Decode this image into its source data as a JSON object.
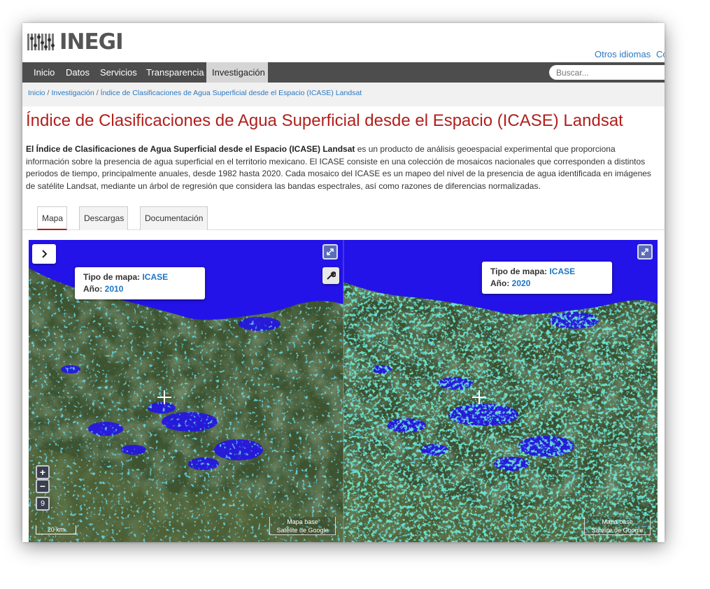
{
  "header": {
    "logo_text": "INEGI",
    "lang_link": "Otros idiomas",
    "extra_link": "Co"
  },
  "nav": {
    "items": [
      "Inicio",
      "Datos",
      "Servicios",
      "Transparencia",
      "Investigación"
    ],
    "search_placeholder": "Buscar..."
  },
  "breadcrumb": {
    "items": [
      "Inicio",
      "Investigación",
      "Índice de Clasificaciones de Agua Superficial desde el Espacio (ICASE) Landsat"
    ],
    "separator": "/"
  },
  "page": {
    "title": "Índice de Clasificaciones de Agua Superficial desde el Espacio (ICASE) Landsat",
    "description_bold": "El Índice de Clasificaciones de Agua Superficial desde el Espacio (ICASE) Landsat",
    "description_rest": " es un producto de análisis geoespacial experimental que proporciona información sobre la presencia de agua superficial en el territorio mexicano. El ICASE consiste en una colección de mosaicos nacionales que corresponden a distintos periodos de tiempo, principalmente anuales, desde 1982 hasta 2020. Cada mosaico del ICASE es un mapeo del nivel de la presencia de agua identificada en imágenes de satélite Landsat, mediante un árbol de regresión que considera las bandas espectrales, así como razones de diferencias normalizadas."
  },
  "tabs": [
    "Mapa",
    "Descargas",
    "Documentación"
  ],
  "map": {
    "toggle_icon": "chevron-right-icon",
    "left": {
      "map_type_label": "Tipo de mapa:",
      "map_type": "ICASE",
      "year_label": "Año:",
      "year": "2010"
    },
    "right": {
      "map_type_label": "Tipo de mapa:",
      "map_type": "ICASE",
      "year_label": "Año:",
      "year": "2020"
    },
    "zoom_in": "+",
    "zoom_out": "−",
    "zoom_level": "9",
    "scale": "20 km",
    "basemap_line1": "Mapa base",
    "basemap_line2": "Satélite de Google",
    "colors": {
      "water": "#2413e8",
      "land": "#3d5230",
      "cyan": "#24c4d8",
      "green": "#2ee07a"
    }
  }
}
